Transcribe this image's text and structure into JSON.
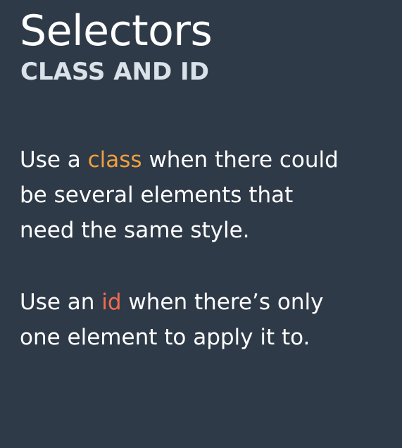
{
  "slide": {
    "title": "Selectors",
    "subtitle": "CLASS AND ID",
    "class_paragraph": {
      "line_1_before": "Use a ",
      "line_1_keyword": "class",
      "line_1_after": " when there could",
      "line_2": "be several elements that",
      "line_3": "need the same style."
    },
    "id_paragraph": {
      "line_1_before": "Use an ",
      "line_1_keyword": "id",
      "line_1_after": " when there’s only",
      "line_2": "one element to apply it to."
    }
  },
  "colors": {
    "background": "#2f3a48",
    "text": "#ffffff",
    "subtitle": "#d9e1e9",
    "class_keyword": "#f0a03d",
    "id_keyword": "#f26b4f"
  }
}
